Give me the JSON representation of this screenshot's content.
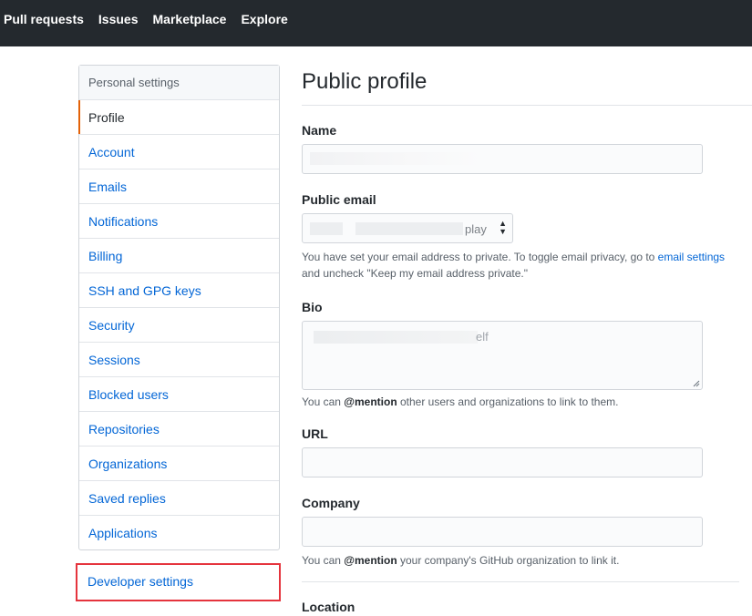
{
  "topnav": {
    "items": [
      "Pull requests",
      "Issues",
      "Marketplace",
      "Explore"
    ]
  },
  "sidebar": {
    "header": "Personal settings",
    "items": [
      {
        "label": "Profile",
        "selected": true
      },
      {
        "label": "Account"
      },
      {
        "label": "Emails"
      },
      {
        "label": "Notifications"
      },
      {
        "label": "Billing"
      },
      {
        "label": "SSH and GPG keys"
      },
      {
        "label": "Security"
      },
      {
        "label": "Sessions"
      },
      {
        "label": "Blocked users"
      },
      {
        "label": "Repositories"
      },
      {
        "label": "Organizations"
      },
      {
        "label": "Saved replies"
      },
      {
        "label": "Applications"
      }
    ],
    "developer_settings": "Developer settings"
  },
  "main": {
    "title": "Public profile",
    "name_label": "Name",
    "public_email_label": "Public email",
    "public_email_visible_tail": "play",
    "email_note_1": "You have set your email address to private. To toggle email privacy, go to",
    "email_settings_link": "email settings",
    "email_note_2": "and uncheck \"Keep my email address private.\"",
    "bio_label": "Bio",
    "bio_visible_tail": "elf",
    "bio_note_1": "You can",
    "bio_note_mention": "@mention",
    "bio_note_2": "other users and organizations to link to them.",
    "url_label": "URL",
    "company_label": "Company",
    "company_note_1": "You can",
    "company_note_mention": "@mention",
    "company_note_2": "your company's GitHub organization to link it.",
    "location_label": "Location"
  },
  "colors": {
    "topbar": "#24292e",
    "link": "#0366d6",
    "selected_accent": "#e36209",
    "highlight_box": "#e5343d"
  }
}
